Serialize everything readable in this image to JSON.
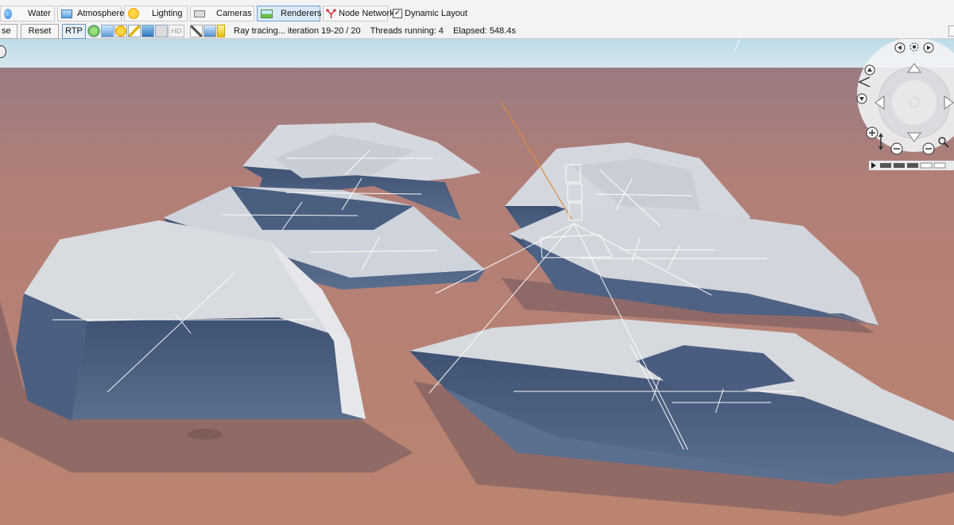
{
  "toolbar": {
    "tabs": [
      {
        "label": "Water",
        "icon": "water-drop-icon"
      },
      {
        "label": "Atmosphere",
        "icon": "atmosphere-icon"
      },
      {
        "label": "Lighting",
        "icon": "sun-icon"
      },
      {
        "label": "Cameras",
        "icon": "camera-icon"
      },
      {
        "label": "Renderers",
        "icon": "renderer-icon",
        "active": true
      },
      {
        "label": "Node Network",
        "icon": "node-network-icon"
      }
    ],
    "dynamic_layout": {
      "label": "Dynamic Layout",
      "checked": true,
      "mark": "✓"
    },
    "pause_label": "se",
    "reset_label": "Reset",
    "rtp_label": "RTP",
    "hd_label": "HD",
    "status": {
      "progress": "Ray tracing... iteration 19-20 / 20",
      "threads": "Threads running: 4",
      "elapsed": "Elapsed: 548.4s"
    }
  },
  "colors": {
    "accent": "#6aa0d8",
    "sky": "#c8e1ec",
    "ground": "#b37b72",
    "rock_top": "#d9dde3",
    "rock_side": "#4a5d7e"
  }
}
